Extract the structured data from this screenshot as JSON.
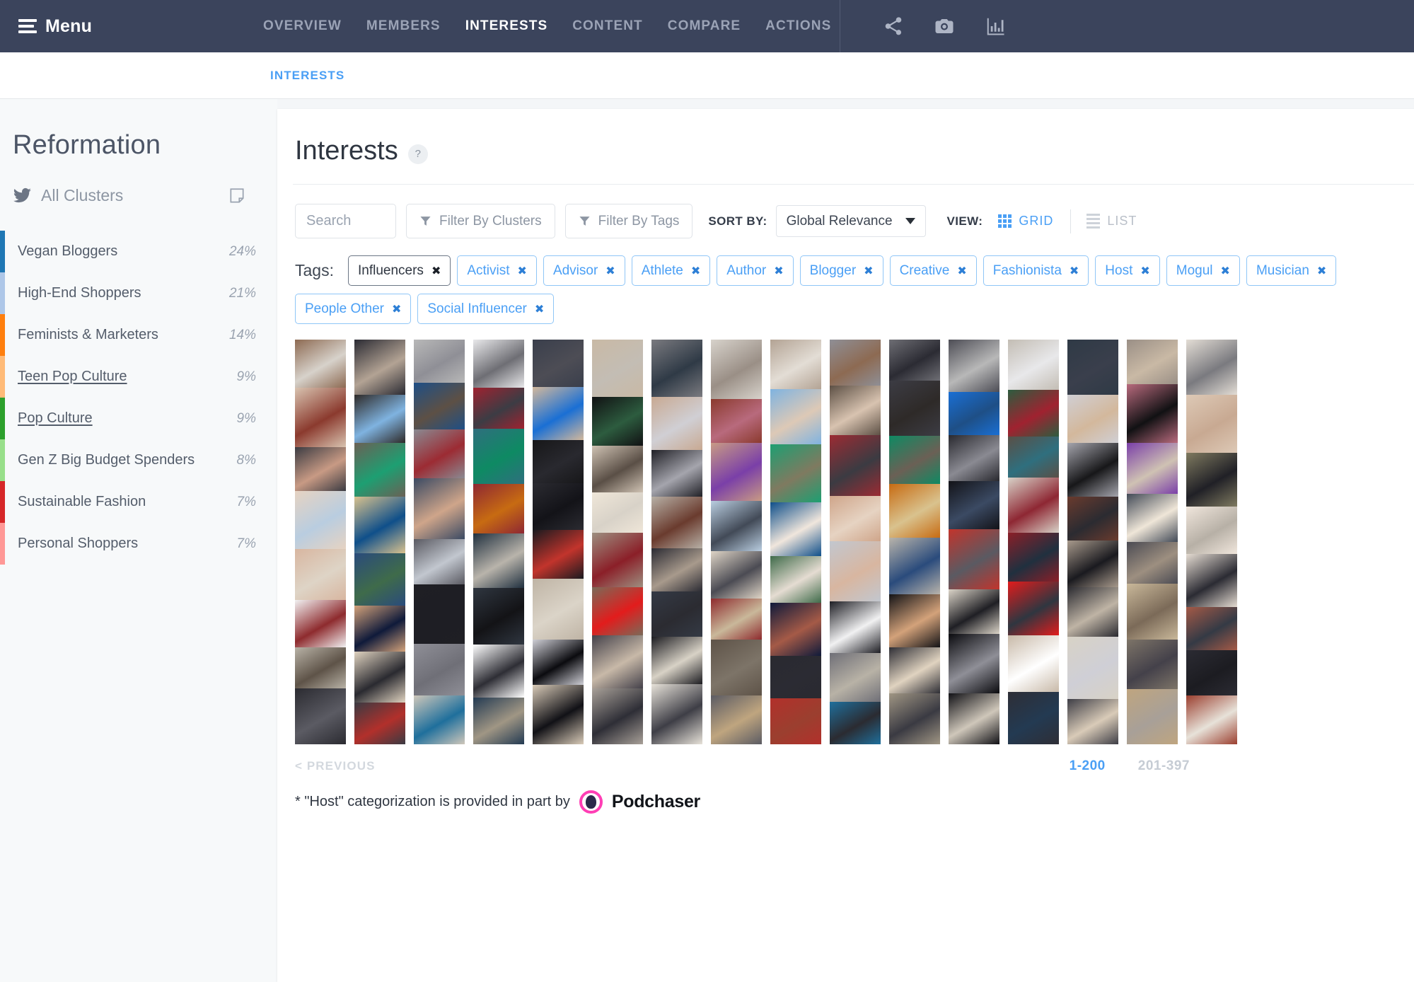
{
  "topnav": {
    "menu_label": "Menu",
    "tabs": [
      {
        "label": "OVERVIEW",
        "active": false
      },
      {
        "label": "MEMBERS",
        "active": false
      },
      {
        "label": "INTERESTS",
        "active": true
      },
      {
        "label": "CONTENT",
        "active": false
      },
      {
        "label": "COMPARE",
        "active": false
      },
      {
        "label": "ACTIONS",
        "active": false
      }
    ],
    "icons": [
      "share-icon",
      "camera-icon",
      "bar-chart-icon"
    ],
    "background": "#3b445c"
  },
  "breadcrumb": {
    "label": "INTERESTS",
    "color": "#4a9ff5"
  },
  "sidebar": {
    "brand": "Reformation",
    "all_clusters": {
      "label": "All Clusters",
      "network_icon": "twitter-icon",
      "note_icon": "note-icon"
    },
    "clusters": [
      {
        "name": "Vegan Bloggers",
        "pct": "24%",
        "color": "#1f77b4",
        "linked": false
      },
      {
        "name": "High-End Shoppers",
        "pct": "21%",
        "color": "#aec7e8",
        "linked": false
      },
      {
        "name": "Feminists & Marketers",
        "pct": "14%",
        "color": "#ff7f0e",
        "linked": false
      },
      {
        "name": "Teen Pop Culture",
        "pct": "9%",
        "color": "#ffbb78",
        "linked": true
      },
      {
        "name": "Pop Culture",
        "pct": "9%",
        "color": "#2ca02c",
        "linked": true
      },
      {
        "name": "Gen Z Big Budget Spenders",
        "pct": "8%",
        "color": "#98df8a",
        "linked": false
      },
      {
        "name": "Sustainable Fashion",
        "pct": "7%",
        "color": "#d62728",
        "linked": false
      },
      {
        "name": "Personal Shoppers",
        "pct": "7%",
        "color": "#ff9896",
        "linked": false
      }
    ]
  },
  "main": {
    "title": "Interests",
    "help_glyph": "?",
    "search": {
      "value": "",
      "placeholder": "Search"
    },
    "filter_clusters_label": "Filter By Clusters",
    "filter_tags_label": "Filter By Tags",
    "sort_by_label": "SORT BY:",
    "sort_value": "Global Relevance",
    "view_label": "VIEW:",
    "view_grid_label": "GRID",
    "view_list_label": "LIST",
    "view_selected": "GRID",
    "tags_label": "Tags:",
    "tags": [
      {
        "label": "Influencers",
        "primary": true
      },
      {
        "label": "Activist",
        "primary": false
      },
      {
        "label": "Advisor",
        "primary": false
      },
      {
        "label": "Athlete",
        "primary": false
      },
      {
        "label": "Author",
        "primary": false
      },
      {
        "label": "Blogger",
        "primary": false
      },
      {
        "label": "Creative",
        "primary": false
      },
      {
        "label": "Fashionista",
        "primary": false
      },
      {
        "label": "Host",
        "primary": false
      },
      {
        "label": "Mogul",
        "primary": false
      },
      {
        "label": "Musician",
        "primary": false
      },
      {
        "label": "People Other",
        "primary": false
      },
      {
        "label": "Social Influencer",
        "primary": false
      }
    ],
    "tag_remove_glyph": "✖",
    "pagination": {
      "previous_label": "< PREVIOUS",
      "pages": [
        {
          "label": "1-200",
          "active": true
        },
        {
          "label": "201-397",
          "active": false
        }
      ]
    },
    "footnote": {
      "text": "* \"Host\" categorization is provided in part by",
      "partner": "Podchaser"
    }
  },
  "grid": {
    "columns": 16,
    "column_tints": [
      [
        "#8d6a52",
        "#2b2b33",
        "#b8b8b8",
        "#e8e8ea",
        "#3a3f4c",
        "#c9b9a5",
        "#7a7a7f",
        "#d7d2cb",
        "#b3a394",
        "#8f8f96",
        "#6e6e74",
        "#4d4d55",
        "#c3bdb4",
        "#2f3a46",
        "#9a8f86",
        "#e3ddd5"
      ],
      [
        "#d8c3b0",
        "#2e2a28",
        "#1e4f86",
        "#a02230",
        "#d3b89c",
        "#111113",
        "#c8a992",
        "#8b3a2e",
        "#7fb3e0",
        "#5d5045",
        "#3c3c44",
        "#1a6fd4",
        "#2d5c3f",
        "#d0cfd4",
        "#b86a7d",
        "#ddc9b6"
      ],
      [
        "#3b3b42",
        "#6b6055",
        "#8a8a92",
        "#2f6f7e",
        "#171719",
        "#cfc2b3",
        "#202026",
        "#c89a84",
        "#1d9f72",
        "#9c2b33",
        "#0e8a63",
        "#29292f",
        "#5a4f46",
        "#a5a5ad",
        "#7a3fa8",
        "#7f7a60"
      ],
      [
        "#e6d3c2",
        "#d9c28e",
        "#3b4a63",
        "#8e2733",
        "#2b2b31",
        "#efe6d8",
        "#b7b0a6",
        "#b9cde0",
        "#0f4f8a",
        "#cfa58a",
        "#c76b12",
        "#131318",
        "#d8d2c8",
        "#6a3b2e",
        "#424a57",
        "#f0e6dc"
      ],
      [
        "#d8b6a0",
        "#2a4b7c",
        "#5a5a62",
        "#20303f",
        "#1a1a1f",
        "#9d8f80",
        "#2b2b33",
        "#ded4c6",
        "#3f6b4a",
        "#c2c7cf",
        "#b9b4ab",
        "#c2342c",
        "#8b1f28",
        "#a89a8c",
        "#4b4b53",
        "#e5dcd2"
      ],
      [
        "#f1f1f2",
        "#d3a27a",
        "#1f1f24",
        "#2f3640",
        "#bfb4a5",
        "#7b6a58",
        "#343a45",
        "#8e2b2e",
        "#0f1a3a",
        "#1e1e24",
        "#131316",
        "#dbd4c8",
        "#e21c1c",
        "#2b2b31",
        "#c9b89a",
        "#a55a47"
      ],
      [
        "#b8b2a6",
        "#e0d3c0",
        "#8f8f97",
        "#ffffff",
        "#cfcfd6",
        "#44414a",
        "#1c1c21",
        "#5e5348",
        "#2a2a30",
        "#6f6f77",
        "#2e2e35",
        "#0b0b0f",
        "#c8b9a8",
        "#d8d2c6",
        "#7d7468",
        "#2b2b33"
      ],
      [
        "#2b2b31",
        "#3a3a42",
        "#cfc7ba",
        "#233a52",
        "#d9cbb8",
        "#a8a098",
        "#e7e2d9",
        "#5b5b63",
        "#b2302b",
        "#1f6f9c",
        "#a09684",
        "#111116",
        "#2e2e36",
        "#3e3e46",
        "#bfa57f",
        "#9b3f2f"
      ],
      [
        "#e4dcd0",
        "#6d6d75",
        "#b0a79a",
        "#1a1a1f",
        "#8e8e96",
        "#2f2f36",
        "#c2b5a4",
        "#d5cdc2",
        "#38383f",
        "#4a4a52",
        "#eae4db",
        "#7f7a72",
        "#545c68",
        "#26262c",
        "#d2c7b6",
        "#1e1e24"
      ]
    ],
    "highlighted_cell": {
      "column": 3,
      "row": 8,
      "outline_color": "#e8352e"
    }
  }
}
